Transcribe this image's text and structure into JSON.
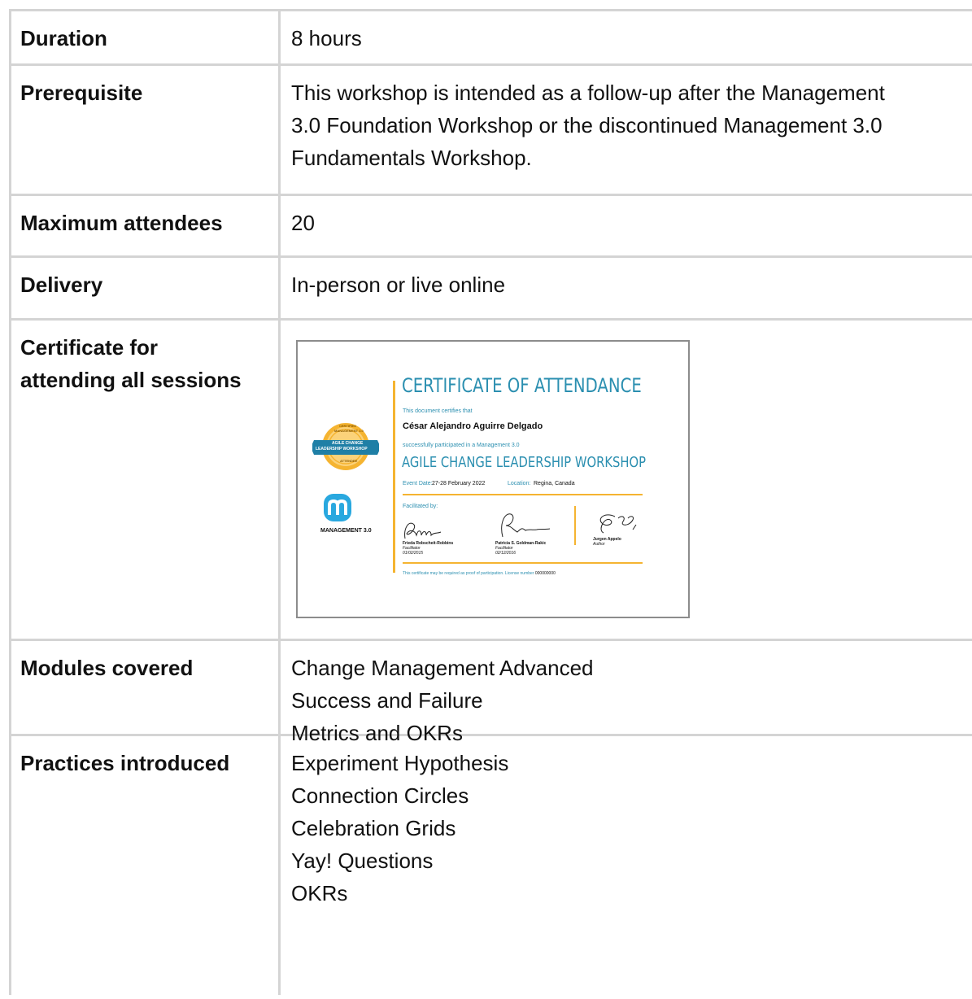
{
  "rows": [
    {
      "label": "Duration",
      "values": [
        "8 hours"
      ]
    },
    {
      "label": "Prerequisite",
      "values": [
        "This workshop is intended as a follow-up after the Management",
        "3.0 Foundation Workshop or the discontinued Management 3.0",
        "Fundamentals Workshop."
      ]
    },
    {
      "label": "Maximum attendees",
      "values": [
        "20"
      ]
    },
    {
      "label": "Delivery",
      "values": [
        "In-person or live online"
      ]
    },
    {
      "label_lines": [
        "Certificate for",
        "attending all sessions"
      ]
    },
    {
      "label": "Modules covered",
      "values": [
        "Change Management Advanced",
        "Success and Failure",
        "Metrics and OKRs"
      ]
    },
    {
      "label": "Practices introduced",
      "values": [
        "Experiment Hypothesis",
        "Connection Circles",
        "Celebration Grids",
        "Yay! Questions",
        "OKRs"
      ]
    }
  ],
  "certificate": {
    "title": "CERTIFICATE OF ATTENDANCE",
    "certifies": "This document certifies that",
    "name": "César Alejandro Aguirre Delgado",
    "participated": "successfully participated in a Management 3.0",
    "workshop": "AGILE CHANGE LEADERSHIP WORKSHOP",
    "event_date_label": "Event Date:",
    "event_date": "27-28 February 2022",
    "location_label": "Location:",
    "location": "Regina, Canada",
    "facilitated_by": "Facilitated by:",
    "signers": [
      {
        "name": "Frieda Robscheit-Robbins",
        "role": "Facilitator",
        "date": "01/02/2015"
      },
      {
        "name": "Patricia S. Goldman-Rakic",
        "role": "Facilitator",
        "date": "02/12/2016"
      },
      {
        "name": "Jurgen Appelo",
        "role": "Author"
      }
    ],
    "footer": "This certificate may be required as proof of participation. License number",
    "license_number": "000000000",
    "badge_lines": [
      "CERTIFIED",
      "MANAGEMENT 3.0",
      "AGILE CHANGE",
      "LEADERSHIP WORKSHOP",
      "ATTENDEE"
    ],
    "brand": "MANAGEMENT 3.0",
    "colors": {
      "accent": "#2b8fb0",
      "gold": "#f5b431",
      "brand_blue": "#29a8df"
    }
  }
}
